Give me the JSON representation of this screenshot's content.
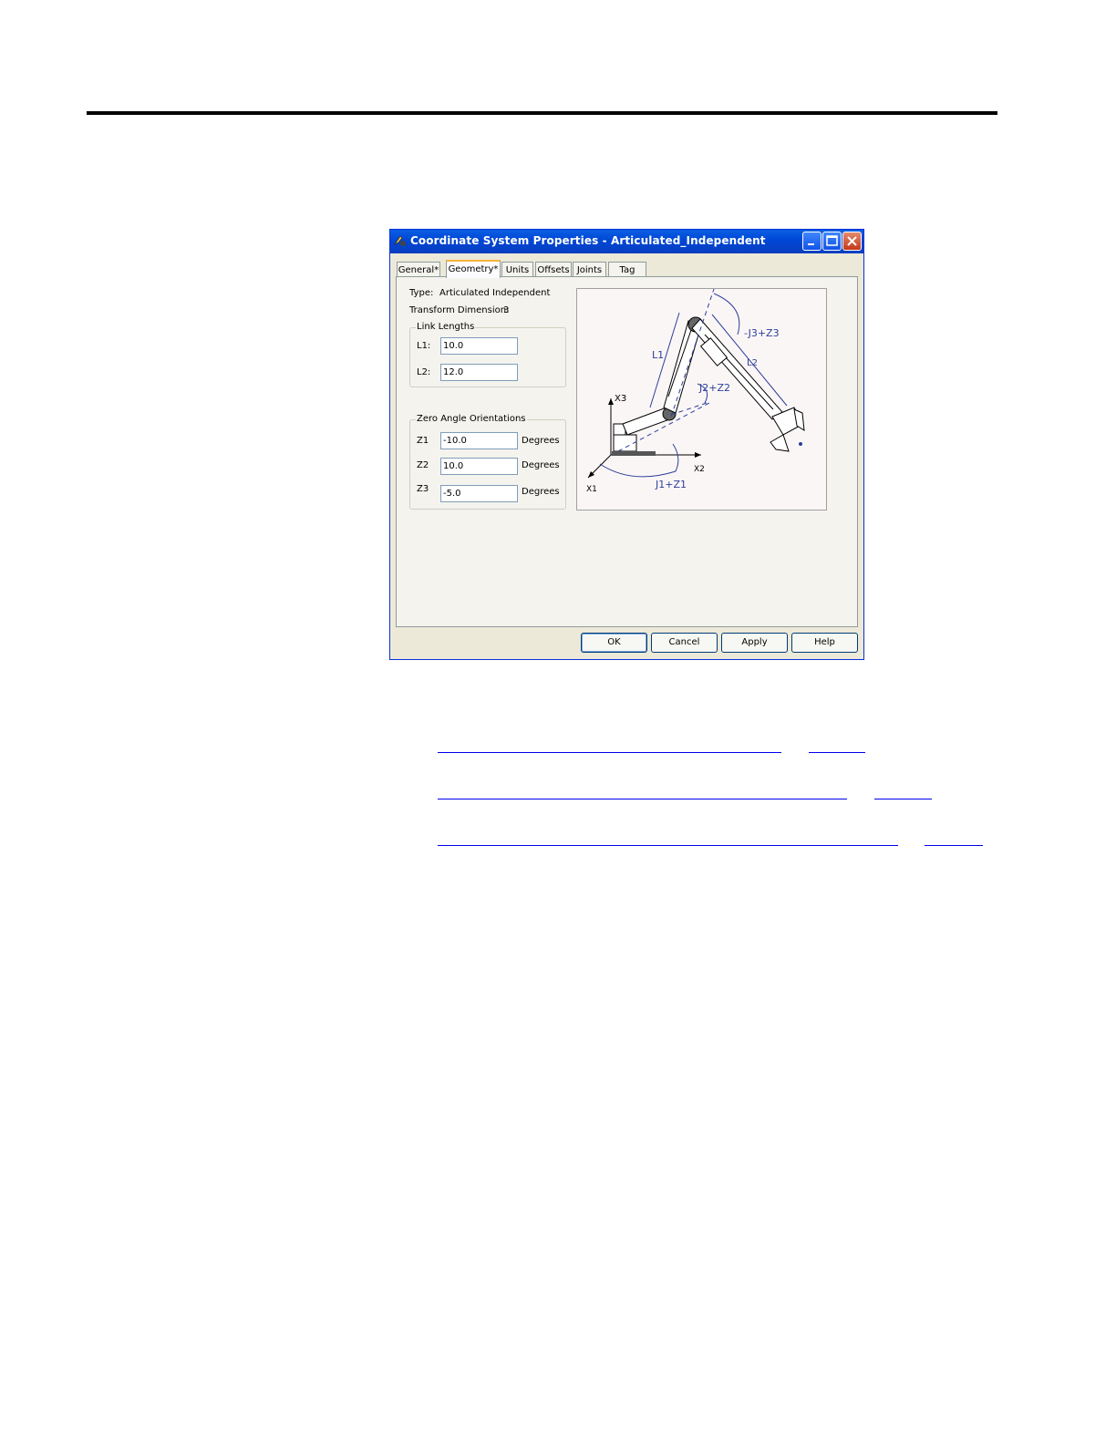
{
  "window": {
    "title": "Coordinate System Properties - Articulated_Independent"
  },
  "tabs": [
    {
      "label": "General*"
    },
    {
      "label": "Geometry*"
    },
    {
      "label": "Units"
    },
    {
      "label": "Offsets"
    },
    {
      "label": "Joints"
    },
    {
      "label": "Tag"
    }
  ],
  "geometry": {
    "type_label": "Type:",
    "type_value": "Articulated Independent",
    "transform_label": "Transform Dimension:",
    "transform_value": "3",
    "link_lengths": {
      "title": "Link Lengths",
      "l1_label": "L1:",
      "l1_value": "10.0",
      "l2_label": "L2:",
      "l2_value": "12.0"
    },
    "zero_angle": {
      "title": "Zero Angle Orientations",
      "units": "Degrees",
      "z1_label": "Z1",
      "z1_value": "-10.0",
      "z2_label": "Z2",
      "z2_value": "10.0",
      "z3_label": "Z3",
      "z3_value": "-5.0"
    }
  },
  "diagram": {
    "labels": {
      "x3": "X3",
      "x2": "X2",
      "x1": "X1",
      "l1": "L1",
      "l2": "L2",
      "j1z1": "J1+Z1",
      "j2z2": "J2+Z2",
      "j3z3": "-J3+Z3"
    },
    "line_color": "#2b3f9a"
  },
  "buttons": {
    "ok": "OK",
    "cancel": "Cancel",
    "apply": "Apply",
    "help": "Help"
  },
  "colors": {
    "titlebar": "#0a5fe3",
    "dialog_bg": "#ece9d8",
    "link": "#0000ee"
  }
}
